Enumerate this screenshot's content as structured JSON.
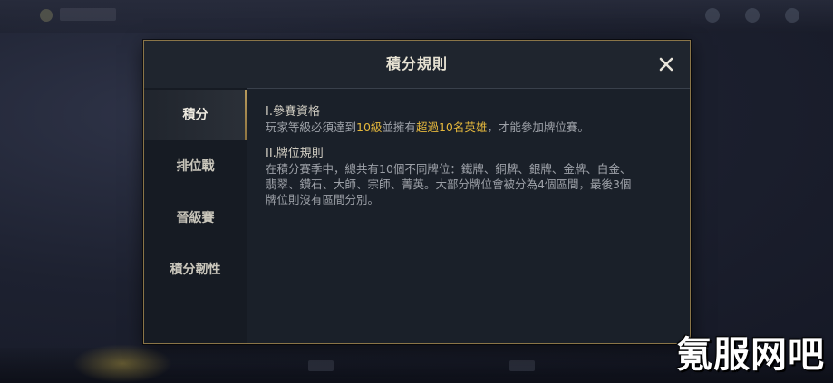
{
  "dialog": {
    "title": "積分規則",
    "close_icon": "close-icon"
  },
  "tabs": [
    {
      "label": "積分",
      "active": true
    },
    {
      "label": "排位戰",
      "active": false
    },
    {
      "label": "晉級賽",
      "active": false
    },
    {
      "label": "積分韌性",
      "active": false
    }
  ],
  "sections": [
    {
      "heading": "I.參賽資格",
      "body": [
        {
          "text": "玩家等級必須達到",
          "highlight": false
        },
        {
          "text": "10級",
          "highlight": true
        },
        {
          "text": "並擁有",
          "highlight": false
        },
        {
          "text": "超過10名英雄",
          "highlight": true
        },
        {
          "text": "，才能參加牌位賽。",
          "highlight": false
        }
      ]
    },
    {
      "heading": "II.牌位規則",
      "body_lines": [
        "在積分賽季中，總共有10個不同牌位：鐵牌、銅牌、銀牌、金牌、白金、",
        "翡翠、鑽石、大師、宗師、菁英。大部分牌位會被分為4個區間，最後3個",
        "牌位則沒有區間分別。"
      ]
    }
  ],
  "watermark": "氪服网吧",
  "colors": {
    "highlight": "#e4b73c",
    "border_gold": "#8a7548",
    "panel_bg": "#1a2029"
  }
}
